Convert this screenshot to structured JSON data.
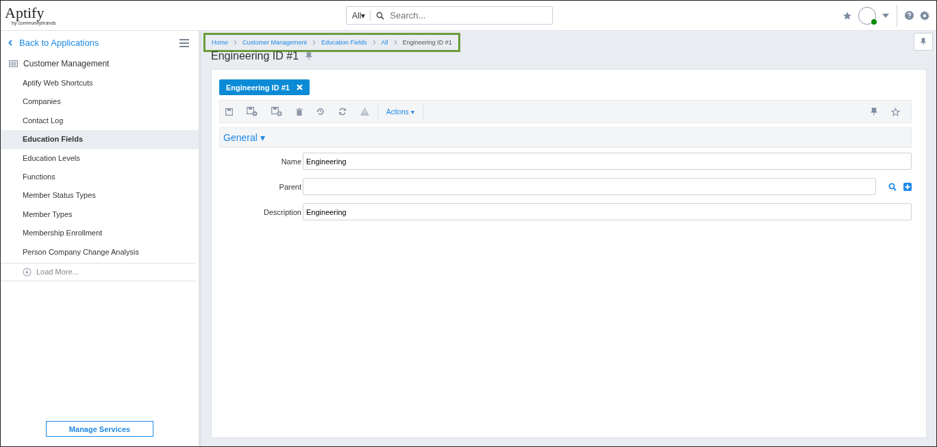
{
  "header": {
    "logo": "Aptify",
    "logo_tagline": "by communitybrands",
    "search_scope": "All▾",
    "search_placeholder": "Search..."
  },
  "sidebar": {
    "back_label": "Back to Applications",
    "section": "Customer Management",
    "items": [
      {
        "label": "Aptify Web Shortcuts",
        "selected": false
      },
      {
        "label": "Companies",
        "selected": false
      },
      {
        "label": "Contact Log",
        "selected": false
      },
      {
        "label": "Education Fields",
        "selected": true
      },
      {
        "label": "Education Levels",
        "selected": false
      },
      {
        "label": "Functions",
        "selected": false
      },
      {
        "label": "Member Status Types",
        "selected": false
      },
      {
        "label": "Member Types",
        "selected": false
      },
      {
        "label": "Membership Enrollment",
        "selected": false
      },
      {
        "label": "Person Company Change Analysis",
        "selected": false
      }
    ],
    "load_more": "Load More...",
    "manage_button": "Manage Services"
  },
  "breadcrumb": [
    {
      "label": "Home",
      "current": false
    },
    {
      "label": "Customer Management",
      "current": false
    },
    {
      "label": "Education Fields",
      "current": false
    },
    {
      "label": "All",
      "current": false
    },
    {
      "label": "Engineering ID #1",
      "current": true
    }
  ],
  "page_title": "Engineering ID #1",
  "record_tab": "Engineering ID #1",
  "toolbar": {
    "actions": "Actions ▾"
  },
  "section": {
    "title": "General ▾"
  },
  "fields": [
    {
      "label": "Name",
      "value": "Engineering",
      "kind": "text"
    },
    {
      "label": "Parent",
      "kind": "lookup"
    },
    {
      "label": "Description",
      "value": "Engineering",
      "kind": "text"
    }
  ]
}
